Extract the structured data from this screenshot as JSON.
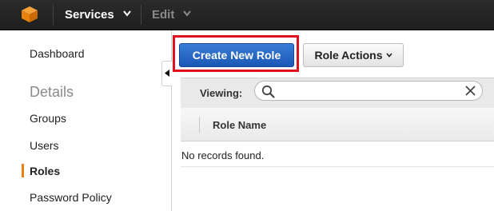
{
  "topbar": {
    "logo_icon": "aws-cube-icon",
    "services_label": "Services",
    "edit_label": "Edit",
    "colors": {
      "bar": "#232323",
      "logo": "#f0901b"
    }
  },
  "sidebar": {
    "items": [
      {
        "label": "Dashboard",
        "type": "link"
      },
      {
        "label": "Details",
        "type": "heading"
      },
      {
        "label": "Groups",
        "type": "link"
      },
      {
        "label": "Users",
        "type": "link"
      },
      {
        "label": "Roles",
        "type": "link",
        "active": true
      },
      {
        "label": "Password Policy",
        "type": "link"
      }
    ],
    "active_color": "#e8820c"
  },
  "toolbar": {
    "create_label": "Create New Role",
    "actions_label": "Role Actions",
    "highlight_color": "#e0101e"
  },
  "filter": {
    "viewing_label": "Viewing:",
    "search_value": ""
  },
  "table": {
    "columns": [
      "Role Name"
    ],
    "rows": [],
    "empty_message": "No records found."
  }
}
